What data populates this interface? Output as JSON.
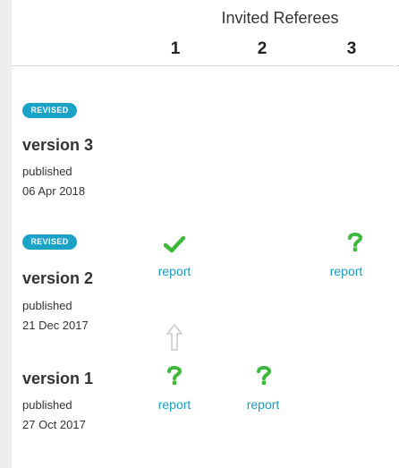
{
  "header": {
    "title": "Invited Referees",
    "columns": [
      "1",
      "2",
      "3"
    ]
  },
  "versions": [
    {
      "badge": "REVISED",
      "title": "version 3",
      "published_label": "published",
      "date": "06 Apr 2018"
    },
    {
      "badge": "REVISED",
      "title": "version 2",
      "published_label": "published",
      "date": "21 Dec 2017"
    },
    {
      "title": "version 1",
      "published_label": "published",
      "date": "27 Oct 2017"
    }
  ],
  "reports": {
    "v2_ref1": {
      "status": "approved",
      "icon": "checkmark-icon",
      "label": "report"
    },
    "v2_ref3": {
      "status": "pending",
      "icon": "question-icon",
      "label": "report"
    },
    "v1_ref1": {
      "status": "pending",
      "icon": "question-icon",
      "label": "report"
    },
    "v1_ref2": {
      "status": "pending",
      "icon": "question-icon",
      "label": "report"
    }
  },
  "colors": {
    "accent": "#1a9ac4",
    "badge": "#1aa3c5",
    "status_green": "#3db83a",
    "arrow_gray": "#c9c9c9",
    "side_bar": "#eeeeee"
  },
  "icons": {
    "connector": "up-arrow-icon"
  }
}
